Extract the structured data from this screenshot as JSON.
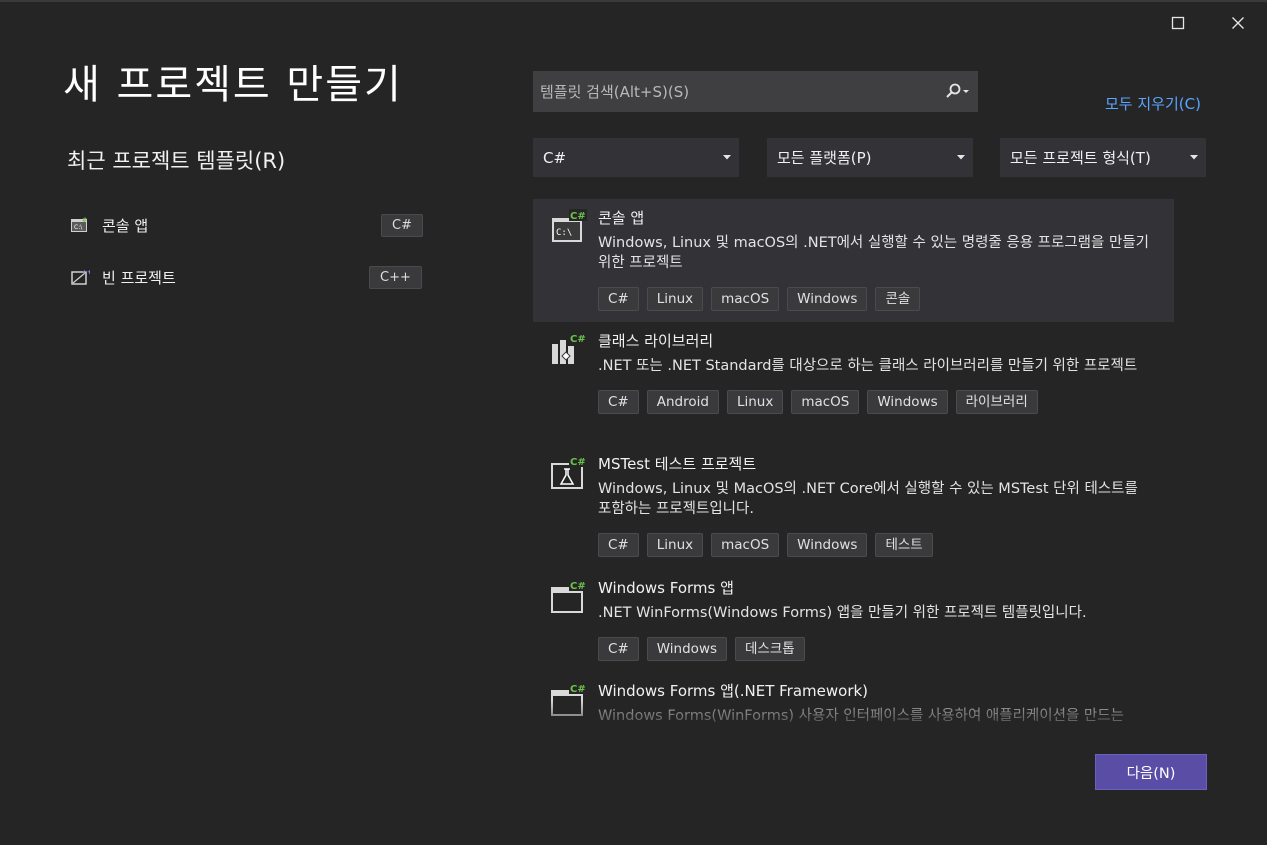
{
  "window": {
    "maximize_icon": "maximize-icon",
    "close_icon": "close-icon"
  },
  "title": "새 프로젝트 만들기",
  "recent": {
    "heading": "최근 프로젝트 템플릿(R)",
    "items": [
      {
        "label": "콘솔 앱",
        "lang": "C#",
        "icon": "console-app-icon"
      },
      {
        "label": "빈 프로젝트",
        "lang": "C++",
        "icon": "empty-project-icon"
      }
    ]
  },
  "search": {
    "placeholder": "템플릿 검색(Alt+S)(S)",
    "value": ""
  },
  "clear_all": "모두 지우기(C)",
  "filters": {
    "language": "C#",
    "platform": "모든 플랫폼(P)",
    "project_type": "모든 프로젝트 형식(T)"
  },
  "templates": [
    {
      "name": "콘솔 앱",
      "description": "Windows, Linux 및 macOS의 .NET에서 실행할 수 있는 명령줄 응용 프로그램을 만들기 위한 프로젝트",
      "tags": [
        "C#",
        "Linux",
        "macOS",
        "Windows",
        "콘솔"
      ],
      "badge": "C#"
    },
    {
      "name": "클래스 라이브러리",
      "description": ".NET 또는 .NET Standard를 대상으로 하는 클래스 라이브러리를 만들기 위한 프로젝트",
      "tags": [
        "C#",
        "Android",
        "Linux",
        "macOS",
        "Windows",
        "라이브러리"
      ],
      "badge": "C#"
    },
    {
      "name": "MSTest 테스트 프로젝트",
      "description": "Windows, Linux 및 MacOS의 .NET Core에서 실행할 수 있는 MSTest 단위 테스트를 포함하는 프로젝트입니다.",
      "tags": [
        "C#",
        "Linux",
        "macOS",
        "Windows",
        "테스트"
      ],
      "badge": "C#"
    },
    {
      "name": "Windows Forms 앱",
      "description": ".NET WinForms(Windows Forms) 앱을 만들기 위한 프로젝트 템플릿입니다.",
      "tags": [
        "C#",
        "Windows",
        "데스크톱"
      ],
      "badge": "C#"
    },
    {
      "name": "Windows Forms 앱(.NET Framework)",
      "description": "Windows Forms(WinForms) 사용자 인터페이스를 사용하여 애플리케이션을 만드는",
      "tags": [],
      "badge": "C#"
    }
  ],
  "next_button": "다음(N)",
  "colors": {
    "accent": "#5a4da5",
    "link": "#5aa5ff",
    "csharp_badge": "#6cc24a"
  }
}
